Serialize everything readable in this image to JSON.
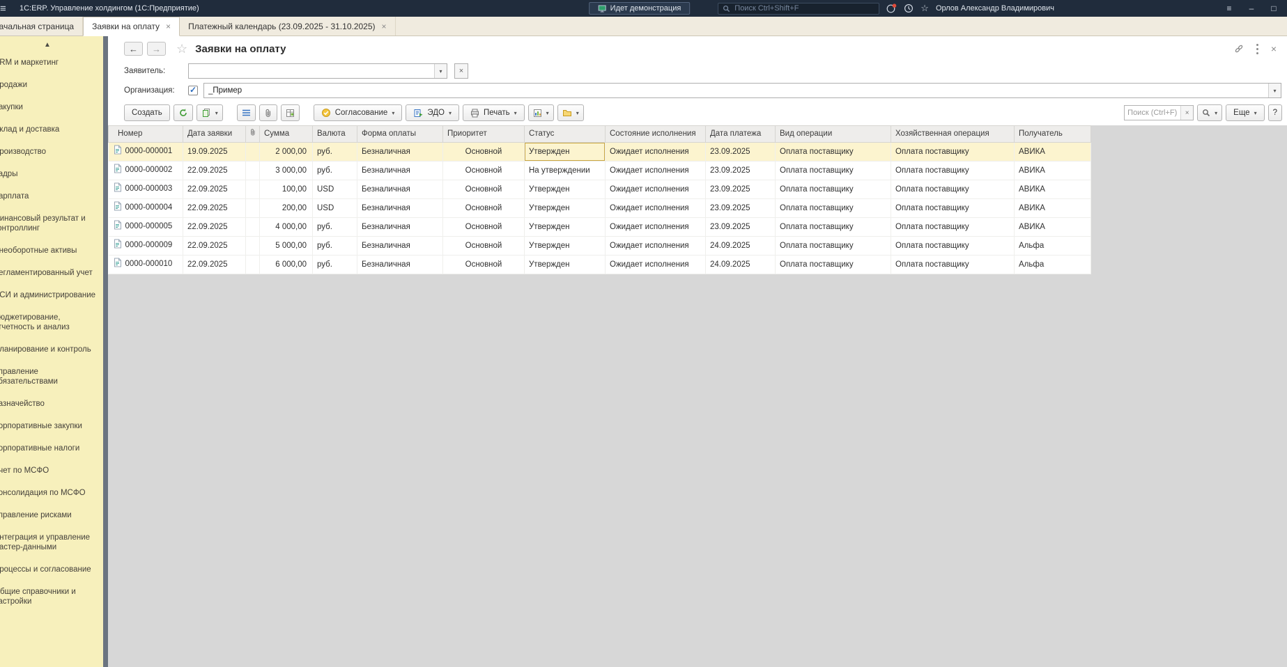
{
  "topbar": {
    "title": "1С:ERP. Управление холдингом (1С:Предприятие)",
    "demo_badge": "Идет демонстрация",
    "search_placeholder": "Поиск Ctrl+Shift+F",
    "user_name": "Орлов Александр Владимирович"
  },
  "tabs": [
    {
      "label": "Начальная страница",
      "active": false
    },
    {
      "label": "Заявки на оплату",
      "active": true
    },
    {
      "label": "Платежный календарь (23.09.2025 - 31.10.2025)",
      "active": false
    }
  ],
  "sidebar": {
    "items": [
      "CRM и маркетинг",
      "Продажи",
      "Закупки",
      "Склад и доставка",
      "Производство",
      "Кадры",
      "Зарплата",
      "Финансовый результат и контроллинг",
      "Внеоборотные активы",
      "Регламентированный учет",
      "НСИ и администрирование",
      "Бюджетирование, отчетность и анализ",
      "Планирование и контроль",
      "Управление обязательствами",
      "Казначейство",
      "Корпоративные закупки",
      "Корпоративные налоги",
      "Учет по МСФО",
      "Консолидация по МСФО",
      "Управление рисками",
      "Интеграция и управление мастер-данными",
      "Процессы и согласование",
      "Общие справочники и настройки"
    ]
  },
  "page": {
    "title": "Заявки на оплату",
    "filters": {
      "applicant_label": "Заявитель:",
      "applicant_value": "",
      "organization_label": "Организация:",
      "organization_checked": true,
      "organization_value": "_Пример"
    },
    "toolbar": {
      "create_label": "Создать",
      "approval_label": "Согласование",
      "edo_label": "ЭДО",
      "print_label": "Печать",
      "search_placeholder": "Поиск (Ctrl+F)",
      "more_label": "Еще",
      "help_label": "?"
    },
    "table": {
      "columns": [
        "Номер",
        "Дата заявки",
        "",
        "Сумма",
        "Валюта",
        "Форма оплаты",
        "Приоритет",
        "Статус",
        "Состояние исполнения",
        "Дата платежа",
        "Вид операции",
        "Хозяйственная операция",
        "Получатель"
      ],
      "rows": [
        {
          "selected": true,
          "number": "0000-000001",
          "date": "19.09.2025",
          "amount": "2 000,00",
          "currency": "руб.",
          "payment_form": "Безналичная",
          "priority": "Основной",
          "status": "Утвержден",
          "execution_state": "Ожидает исполнения",
          "payment_date": "23.09.2025",
          "operation_type": "Оплата поставщику",
          "business_operation": "Оплата поставщику",
          "recipient": "АВИКА"
        },
        {
          "number": "0000-000002",
          "date": "22.09.2025",
          "amount": "3 000,00",
          "currency": "руб.",
          "payment_form": "Безналичная",
          "priority": "Основной",
          "status": "На утверждении",
          "execution_state": "Ожидает исполнения",
          "payment_date": "23.09.2025",
          "operation_type": "Оплата поставщику",
          "business_operation": "Оплата поставщику",
          "recipient": "АВИКА"
        },
        {
          "number": "0000-000003",
          "date": "22.09.2025",
          "amount": "100,00",
          "currency": "USD",
          "payment_form": "Безналичная",
          "priority": "Основной",
          "status": "Утвержден",
          "execution_state": "Ожидает исполнения",
          "payment_date": "23.09.2025",
          "operation_type": "Оплата поставщику",
          "business_operation": "Оплата поставщику",
          "recipient": "АВИКА"
        },
        {
          "number": "0000-000004",
          "date": "22.09.2025",
          "amount": "200,00",
          "currency": "USD",
          "payment_form": "Безналичная",
          "priority": "Основной",
          "status": "Утвержден",
          "execution_state": "Ожидает исполнения",
          "payment_date": "23.09.2025",
          "operation_type": "Оплата поставщику",
          "business_operation": "Оплата поставщику",
          "recipient": "АВИКА"
        },
        {
          "number": "0000-000005",
          "date": "22.09.2025",
          "amount": "4 000,00",
          "currency": "руб.",
          "payment_form": "Безналичная",
          "priority": "Основной",
          "status": "Утвержден",
          "execution_state": "Ожидает исполнения",
          "payment_date": "23.09.2025",
          "operation_type": "Оплата поставщику",
          "business_operation": "Оплата поставщику",
          "recipient": "АВИКА"
        },
        {
          "number": "0000-000009",
          "date": "22.09.2025",
          "amount": "5 000,00",
          "currency": "руб.",
          "payment_form": "Безналичная",
          "priority": "Основной",
          "status": "Утвержден",
          "execution_state": "Ожидает исполнения",
          "payment_date": "24.09.2025",
          "operation_type": "Оплата поставщику",
          "business_operation": "Оплата поставщику",
          "recipient": "Альфа"
        },
        {
          "number": "0000-000010",
          "date": "22.09.2025",
          "amount": "6 000,00",
          "currency": "руб.",
          "payment_form": "Безналичная",
          "priority": "Основной",
          "status": "Утвержден",
          "execution_state": "Ожидает исполнения",
          "payment_date": "24.09.2025",
          "operation_type": "Оплата поставщику",
          "business_operation": "Оплата поставщику",
          "recipient": "Альфа"
        }
      ]
    }
  },
  "icons": {
    "menu": "≡",
    "minimize": "–",
    "maximize": "□",
    "close": "×",
    "dropdown": "▾",
    "up": "▲",
    "back": "←",
    "forward": "→",
    "star": "☆",
    "check": "✓"
  },
  "colors": {
    "topbar_bg": "#202c3c",
    "sidebar_bg": "#f7f0bc",
    "selected_row": "#fcf4cf",
    "current_cell": "#f8e79b",
    "current_cell_border": "#c9a640",
    "table_header_bg": "#eeedeb",
    "empty_area": "#d7d7d7",
    "checkbox_accent": "#2e6ebf"
  }
}
